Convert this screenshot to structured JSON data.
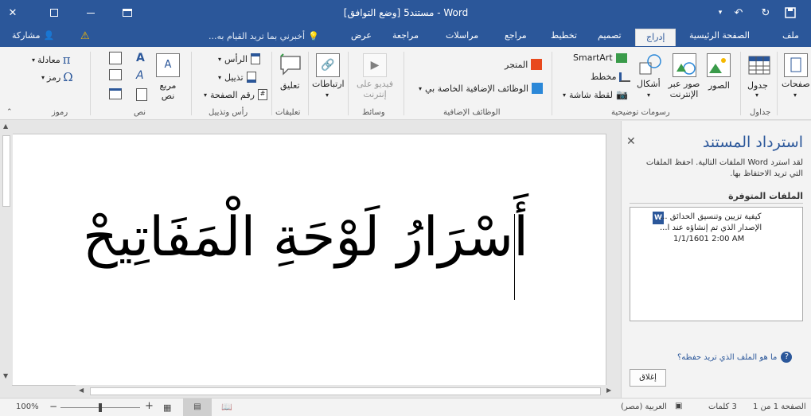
{
  "window": {
    "title": "مستند5 [وضع التوافق] - Word",
    "share_label": "مشاركة",
    "tell_me_placeholder": "أخبرني بما تريد القيام به..."
  },
  "tabs": [
    "ملف",
    "الصفحة الرئيسية",
    "إدراج",
    "تصميم",
    "تخطيط",
    "مراجع",
    "مراسلات",
    "مراجعة",
    "عرض"
  ],
  "active_tab": "إدراج",
  "ribbon": {
    "pages": {
      "label": "صفحات"
    },
    "tables": {
      "table_label": "جدول",
      "group": "جداول"
    },
    "illustrations": {
      "pictures": "الصور",
      "online_pictures": "صور عبر الإنترنت",
      "shapes": "أشكال",
      "smartart": "SmartArt",
      "chart": "مخطط",
      "screenshot": "لقطة شاشة",
      "group": "رسومات توضيحية"
    },
    "addins": {
      "store": "المتجر",
      "my_addins": "الوظائف الإضافية الخاصة بي",
      "group": "الوظائف الإضافية"
    },
    "media": {
      "online_video": "فيديو على إنترنت",
      "group": "وسائط"
    },
    "links": {
      "label": "ارتباطات"
    },
    "comments": {
      "comment": "تعليق",
      "group": "تعليقات"
    },
    "header_footer": {
      "header": "الرأس",
      "footer": "تذييل",
      "page_number": "رقم الصفحة",
      "group": "رأس وتذييل"
    },
    "text": {
      "text_box": "مربع نص",
      "group": "نص"
    },
    "symbols": {
      "equation": "معادلة",
      "symbol": "رمز",
      "group": "رموز"
    }
  },
  "document": {
    "text": "أَسْرَارُ لَوْحَةِ الْمَفَاتِيحْ"
  },
  "recovery_pane": {
    "title": "استرداد المستند",
    "description": "لقد استرد Word الملفات التالية. احفظ الملفات التي تريد الاحتفاظ بها.",
    "available_files_label": "الملفات المتوفرة",
    "file": {
      "name": "كيفية تزيين وتنسيق الحدائق ...",
      "version": "الإصدار الذي تم إنشاؤه عند آ...",
      "time": "1/1/1601 2:00 AM"
    },
    "help_link": "ما هو الملف الذي تريد حفظه؟",
    "close_button": "إغلاق"
  },
  "status_bar": {
    "page": "الصفحة 1 من 1",
    "words": "3 كلمات",
    "language": "العربية (مصر)",
    "zoom": "100%",
    "zoom_level": 1.0
  },
  "colors": {
    "accent": "#2b579a",
    "warning": "#f5b800"
  }
}
